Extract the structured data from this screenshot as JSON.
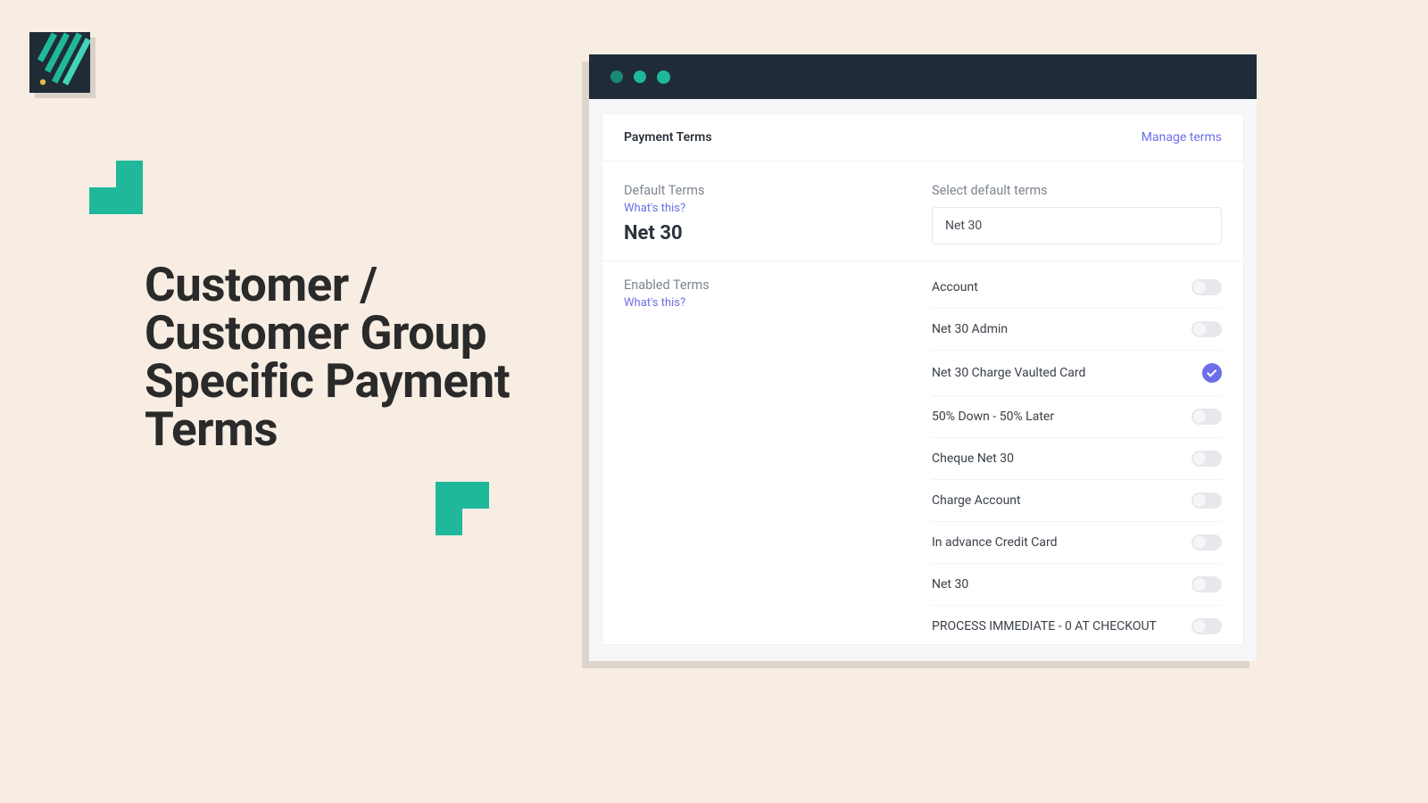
{
  "headline": "Customer / Customer Group Specific Payment Terms",
  "panel": {
    "header": {
      "title": "Payment Terms",
      "manage": "Manage terms"
    },
    "default_section": {
      "label": "Default Terms",
      "help": "What's this?",
      "value": "Net 30"
    },
    "select_section": {
      "label": "Select default terms",
      "selected": "Net 30"
    },
    "enabled_section": {
      "label": "Enabled Terms",
      "help": "What's this?"
    },
    "terms": [
      {
        "label": "Account",
        "enabled": false
      },
      {
        "label": "Net 30 Admin",
        "enabled": false
      },
      {
        "label": "Net 30 Charge Vaulted Card",
        "enabled": true
      },
      {
        "label": "50% Down - 50% Later",
        "enabled": false
      },
      {
        "label": "Cheque Net 30",
        "enabled": false
      },
      {
        "label": "Charge Account",
        "enabled": false
      },
      {
        "label": "In advance Credit Card",
        "enabled": false
      },
      {
        "label": "Net 30",
        "enabled": false
      },
      {
        "label": "PROCESS IMMEDIATE - 0 AT CHECKOUT",
        "enabled": false
      }
    ]
  }
}
